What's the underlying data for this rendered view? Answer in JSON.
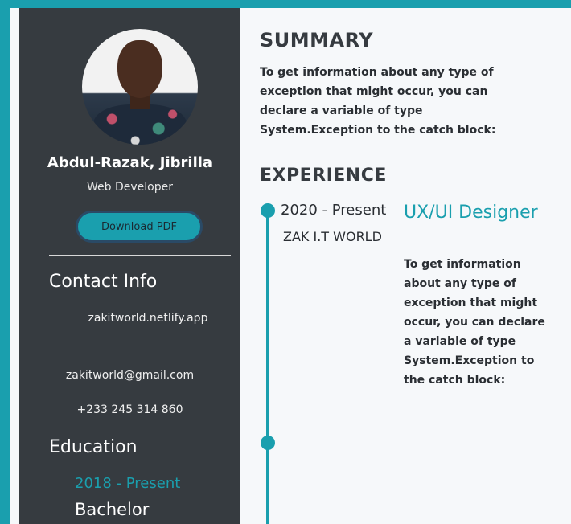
{
  "colors": {
    "accent": "#1a9fae",
    "sidebar_bg": "#363b40",
    "main_bg": "#f6f8fa"
  },
  "profile": {
    "name": "Abdul-Razak, Jibrilla",
    "role": "Web Developer",
    "download_label": "Download PDF"
  },
  "contact": {
    "heading": "Contact Info",
    "website": "zakitworld.netlify.app",
    "email": "zakitworld@gmail.com",
    "phone": "+233 245 314 860"
  },
  "education": {
    "heading": "Education",
    "items": [
      {
        "date": "2018 - Present",
        "degree": "Bachelor"
      }
    ]
  },
  "summary": {
    "heading": "SUMMARY",
    "text": "To get information about any type of exception that might occur, you can declare a variable of type System.Exception to the catch block:"
  },
  "experience": {
    "heading": "EXPERIENCE",
    "items": [
      {
        "date": "2020 - Present",
        "company": "ZAK I.T WORLD",
        "title": "UX/UI Designer",
        "description": "To get information about any type of exception that might occur, you can declare a variable of type System.Exception to the catch block:"
      }
    ]
  }
}
